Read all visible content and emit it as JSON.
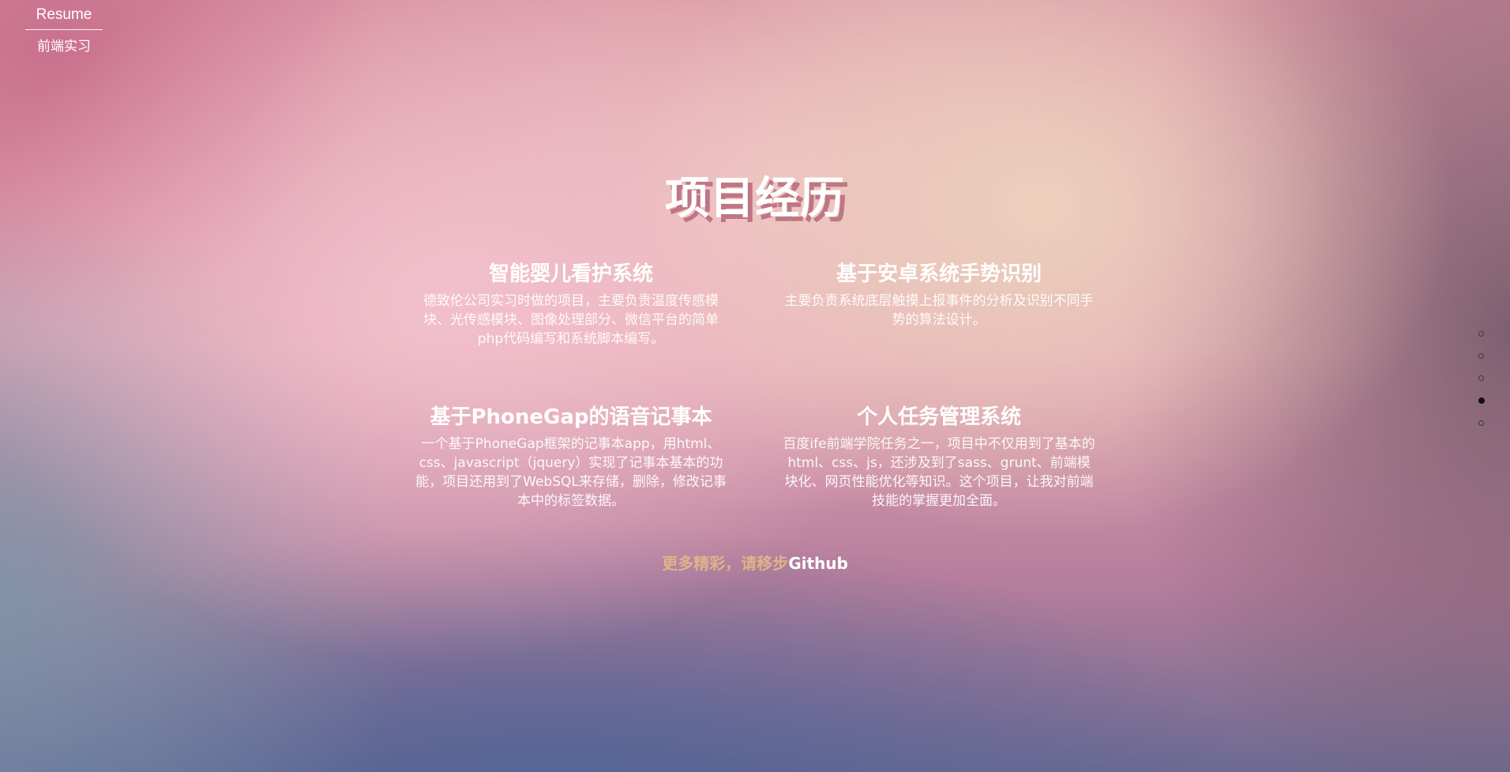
{
  "brand": {
    "title": "Resume",
    "subtitle": "前端实习"
  },
  "section": {
    "title": "项目经历"
  },
  "projects": [
    {
      "title": "智能婴儿看护系统",
      "description": "德致伦公司实习时做的项目，主要负责温度传感模块、光传感模块、图像处理部分、微信平台的简单php代码编写和系统脚本编写。"
    },
    {
      "title": "基于安卓系统手势识别",
      "description": "主要负责系统底层触摸上报事件的分析及识别不同手势的算法设计。"
    },
    {
      "title": "基于PhoneGap的语音记事本",
      "description": "一个基于PhoneGap框架的记事本app，用html、css、javascript（jquery）实现了记事本基本的功能，项目还用到了WebSQL来存储，删除，修改记事本中的标签数据。"
    },
    {
      "title": "个人任务管理系统",
      "description": "百度ife前端学院任务之一，项目中不仅用到了基本的html、css、js，还涉及到了sass、grunt、前端模块化、网页性能优化等知识。这个项目，让我对前端技能的掌握更加全面。"
    }
  ],
  "more": {
    "prefix": "更多精彩，请移步",
    "link_label": "Github"
  },
  "pager": {
    "total": 5,
    "active_index": 3
  },
  "colors": {
    "accent_prefix": "#dfb38a",
    "text": "#ffffff",
    "active_dot": "#111111"
  }
}
